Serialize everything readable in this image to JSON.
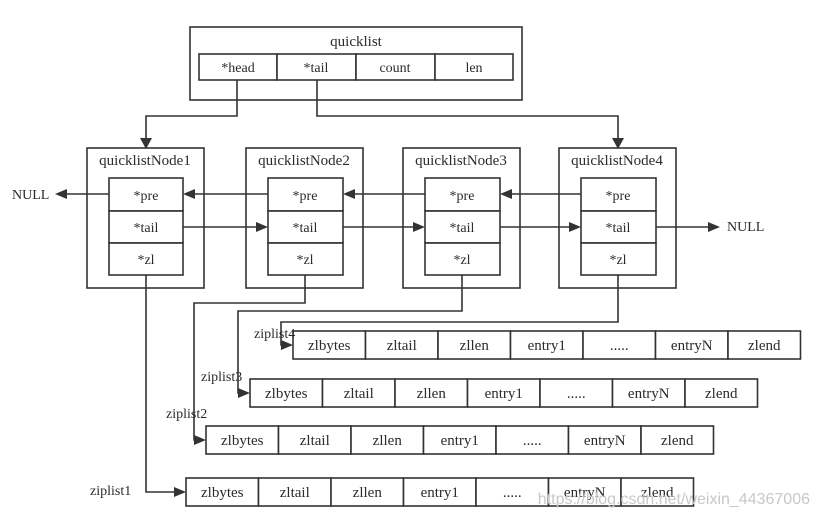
{
  "quicklist": {
    "title": "quicklist",
    "fields": [
      "*head",
      "*tail",
      "count",
      "len"
    ]
  },
  "nodes": [
    {
      "title": "quicklistNode1",
      "fields": [
        "*pre",
        "*tail",
        "*zl"
      ]
    },
    {
      "title": "quicklistNode2",
      "fields": [
        "*pre",
        "*tail",
        "*zl"
      ]
    },
    {
      "title": "quicklistNode3",
      "fields": [
        "*pre",
        "*tail",
        "*zl"
      ]
    },
    {
      "title": "quicklistNode4",
      "fields": [
        "*pre",
        "*tail",
        "*zl"
      ]
    }
  ],
  "null_left": "NULL",
  "null_right": "NULL",
  "ziplists": [
    {
      "label": "ziplist4",
      "fields": [
        "zlbytes",
        "zltail",
        "zllen",
        "entry1",
        ".....",
        "entryN",
        "zlend"
      ]
    },
    {
      "label": "ziplist3",
      "fields": [
        "zlbytes",
        "zltail",
        "zllen",
        "entry1",
        ".....",
        "entryN",
        "zlend"
      ]
    },
    {
      "label": "ziplist2",
      "fields": [
        "zlbytes",
        "zltail",
        "zllen",
        "entry1",
        ".....",
        "entryN",
        "zlend"
      ]
    },
    {
      "label": "ziplist1",
      "fields": [
        "zlbytes",
        "zltail",
        "zllen",
        "entry1",
        ".....",
        "entryN",
        "zlend"
      ]
    }
  ],
  "watermark": "https://blog.csdn.net/weixin_44367006"
}
